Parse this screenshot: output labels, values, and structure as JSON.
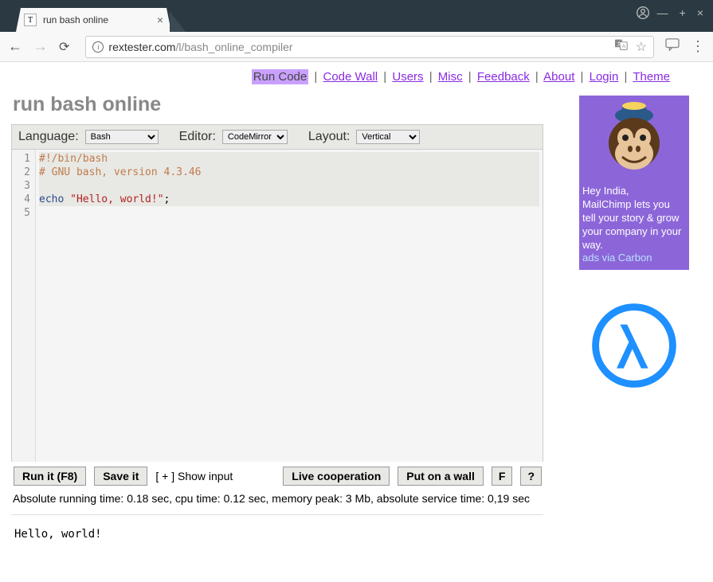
{
  "browser": {
    "tab_title": "run bash online",
    "tab_favicon_letter": "T",
    "url_host": "rextester.com",
    "url_path": "/l/bash_online_compiler"
  },
  "nav": {
    "run_code": "Run Code",
    "code_wall": "Code Wall",
    "users": "Users",
    "misc": "Misc",
    "feedback": "Feedback",
    "about": "About",
    "login": "Login",
    "theme": "Theme"
  },
  "page_title": "run bash online",
  "controls": {
    "language_label": "Language:",
    "language_value": "Bash",
    "editor_label": "Editor:",
    "editor_value": "CodeMirror",
    "layout_label": "Layout:",
    "layout_value": "Vertical"
  },
  "code": {
    "lines": [
      "1",
      "2",
      "3",
      "4",
      "5"
    ],
    "l1_shebang": "#!/bin/bash",
    "l2_comment": "# GNU bash, version 4.3.46",
    "l4_cmd": "echo ",
    "l4_str": "\"Hello, world!\"",
    "l4_semi": ";"
  },
  "buttons": {
    "run": "Run it (F8)",
    "save": "Save it",
    "show_input": "[ + ] Show input",
    "live": "Live cooperation",
    "wall": "Put on a wall",
    "full": "F",
    "help": "?"
  },
  "stats": "Absolute running time: 0.18 sec, cpu time: 0.12 sec, memory peak: 3 Mb, absolute service time: 0,19 sec",
  "output": "Hello, world!",
  "ad": {
    "line1": "Hey India,",
    "line2": "MailChimp lets you tell your story & grow your company in your way.",
    "via": "ads via Carbon"
  }
}
